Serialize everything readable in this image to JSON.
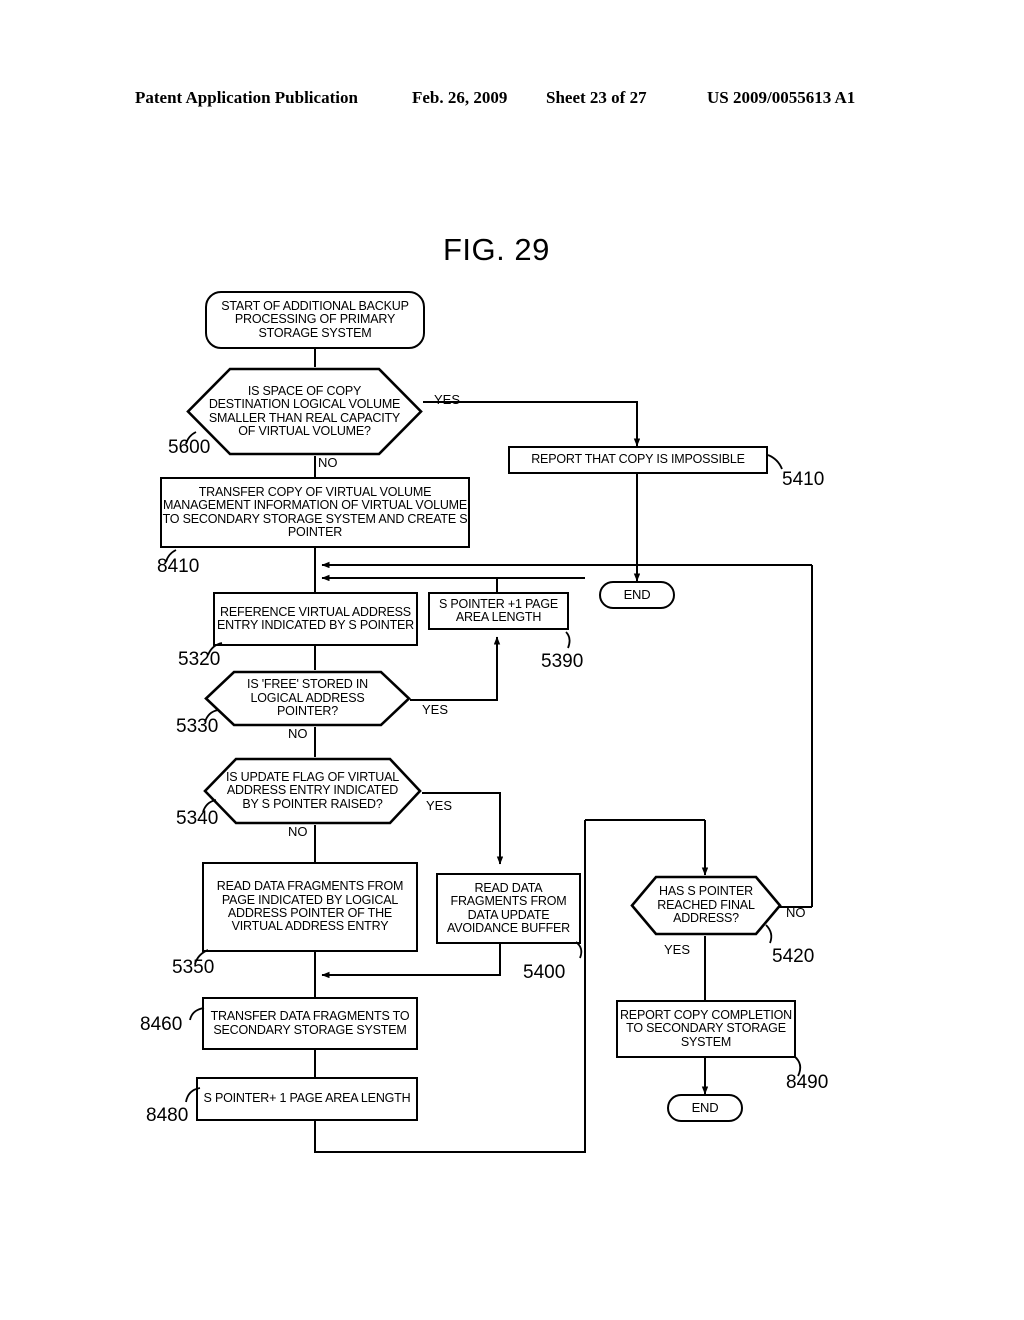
{
  "header": {
    "publication": "Patent Application Publication",
    "date": "Feb. 26, 2009",
    "sheet": "Sheet 23 of 27",
    "patent_number": "US 2009/0055613 A1"
  },
  "figure": {
    "title": "FIG. 29"
  },
  "flowchart": {
    "nodes": [
      {
        "id": "start",
        "type": "terminal",
        "text": "START OF ADDITIONAL BACKUP PROCESSING OF PRIMARY STORAGE SYSTEM"
      },
      {
        "id": "d5600",
        "type": "decision",
        "text": "IS SPACE OF COPY DESTINATION LOGICAL VOLUME SMALLER THAN REAL CAPACITY OF VIRTUAL VOLUME?",
        "ref": "5600"
      },
      {
        "id": "p8410",
        "type": "process",
        "text": "TRANSFER COPY OF VIRTUAL VOLUME MANAGEMENT INFORMATION OF VIRTUAL VOLUME TO SECONDARY STORAGE SYSTEM AND CREATE S POINTER",
        "ref": "8410"
      },
      {
        "id": "p5410",
        "type": "process",
        "text": "REPORT THAT COPY IS IMPOSSIBLE",
        "ref": "5410"
      },
      {
        "id": "end_top",
        "type": "terminal",
        "text": "END"
      },
      {
        "id": "p5320",
        "type": "process",
        "text": "REFERENCE VIRTUAL ADDRESS ENTRY INDICATED BY S POINTER",
        "ref": "5320"
      },
      {
        "id": "p5390",
        "type": "process",
        "text": "S POINTER +1 PAGE AREA LENGTH",
        "ref": "5390"
      },
      {
        "id": "d5330",
        "type": "decision",
        "text": "IS 'FREE' STORED IN LOGICAL ADDRESS POINTER?",
        "ref": "5330"
      },
      {
        "id": "d5340",
        "type": "decision",
        "text": "IS UPDATE FLAG OF VIRTUAL ADDRESS ENTRY INDICATED BY S POINTER RAISED?",
        "ref": "5340"
      },
      {
        "id": "p5350",
        "type": "process",
        "text": "READ DATA FRAGMENTS FROM PAGE INDICATED BY LOGICAL ADDRESS POINTER OF THE VIRTUAL ADDRESS ENTRY",
        "ref": "5350"
      },
      {
        "id": "p5400",
        "type": "process",
        "text": "READ DATA FRAGMENTS FROM DATA UPDATE AVOIDANCE BUFFER",
        "ref": "5400"
      },
      {
        "id": "d5420",
        "type": "decision",
        "text": "HAS S POINTER REACHED FINAL ADDRESS?",
        "ref": "5420"
      },
      {
        "id": "p8460",
        "type": "process",
        "text": "TRANSFER DATA FRAGMENTS TO SECONDARY STORAGE SYSTEM",
        "ref": "8460"
      },
      {
        "id": "p8490",
        "type": "process",
        "text": "REPORT COPY COMPLETION TO SECONDARY STORAGE SYSTEM",
        "ref": "8490"
      },
      {
        "id": "p8480",
        "type": "process",
        "text": "S POINTER+ 1 PAGE AREA LENGTH",
        "ref": "8480"
      },
      {
        "id": "end_bottom",
        "type": "terminal",
        "text": "END"
      }
    ],
    "edge_labels": {
      "d5600_yes": "YES",
      "d5600_no": "NO",
      "d5330_yes": "YES",
      "d5330_no": "NO",
      "d5340_yes": "YES",
      "d5340_no": "NO",
      "d5420_yes": "YES",
      "d5420_no": "NO"
    }
  }
}
